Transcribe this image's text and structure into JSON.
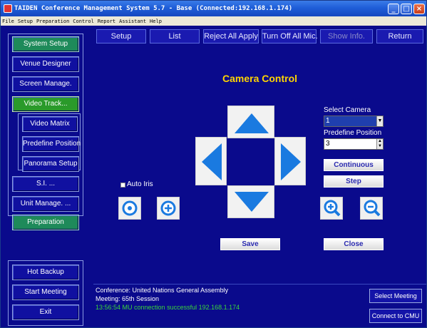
{
  "window": {
    "title": "TAIDEN Conference Management System 5.7 - Base (Connected:192.168.1.174)",
    "min_icon": "minimize-icon",
    "max_icon": "maximize-icon",
    "close_icon": "close-icon"
  },
  "menu": [
    "File",
    "Setup",
    "Preparation",
    "Control",
    "Report",
    "Assistant",
    "Help"
  ],
  "toolbar": {
    "setup": "Setup",
    "list": "List",
    "reject_all": "Reject All Apply",
    "turn_off_mic": "Turn Off All Mic.",
    "show_info": "Show Info.",
    "return": "Return"
  },
  "sidebar": {
    "system_setup": "System Setup",
    "venue_designer": "Venue Designer",
    "screen_manage": "Screen Manage.",
    "video_track": "Video Track...",
    "video_matrix": "Video Matrix",
    "predefine_position": "Predefine Position",
    "panorama_setup": "Panorama Setup",
    "si": "S.I. ...",
    "unit_manage": "Unit Manage. ...",
    "preparation": "Preparation",
    "hot_backup": "Hot Backup",
    "start_meeting": "Start Meeting",
    "exit": "Exit"
  },
  "camera_control": {
    "title": "Camera Control",
    "select_camera_label": "Select Camera",
    "select_camera_value": "1",
    "predefine_position_label": "Predefine Position",
    "predefine_position_value": "3",
    "continuous": "Continuous",
    "step": "Step",
    "auto_iris": "Auto Iris",
    "save": "Save",
    "close": "Close"
  },
  "status": {
    "conference": "Conference: United Nations General Assembly",
    "meeting": "Meeting: 65th Session",
    "log": "13:56:54 MU connection successful 192.168.1.174",
    "select_meeting": "Select Meeting",
    "connect_cmu": "Connect to CMU"
  },
  "colors": {
    "background": "#0a0a8c",
    "title_accent": "#ffd400",
    "arrow_blue": "#1a7ae0",
    "log_green": "#3ad63a"
  }
}
